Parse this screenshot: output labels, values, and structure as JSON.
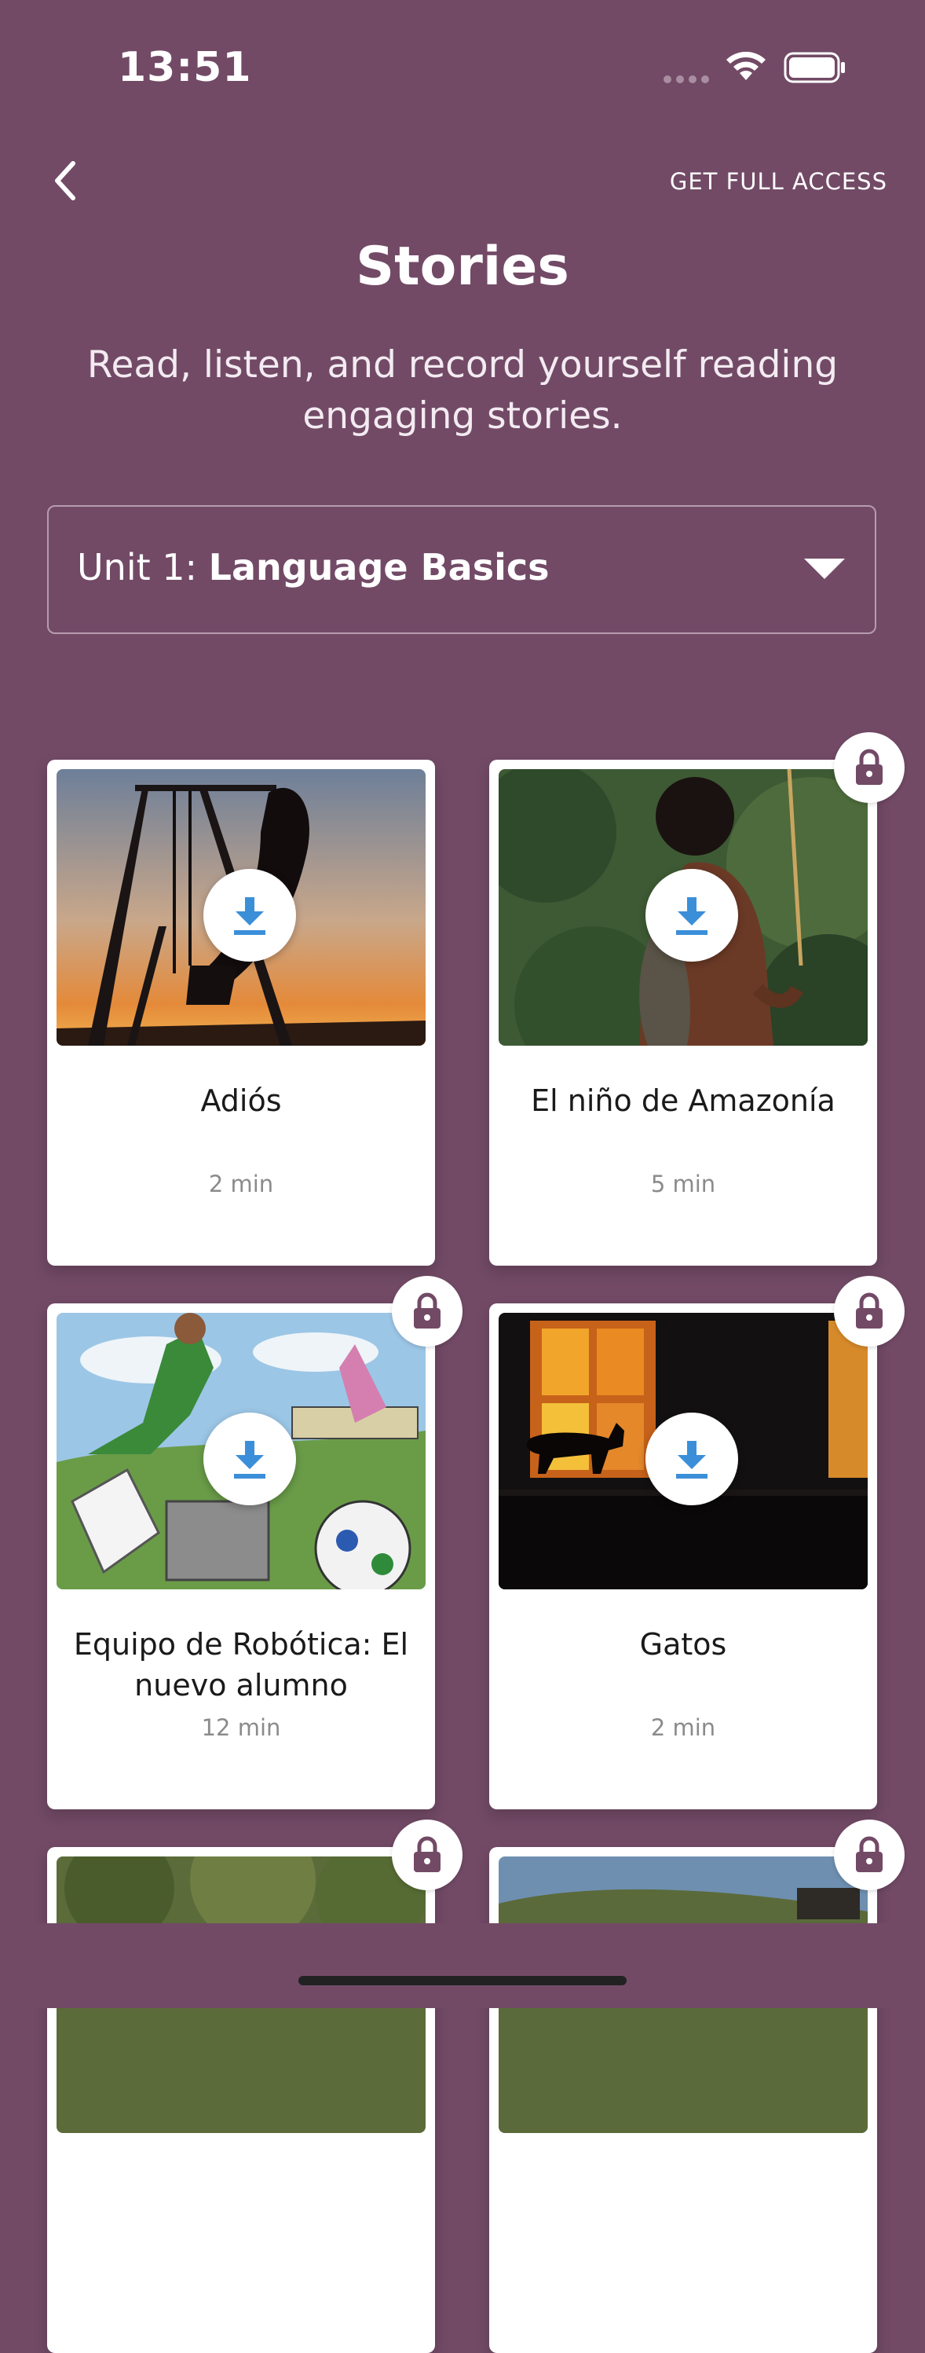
{
  "status_bar": {
    "time": "13:51"
  },
  "header": {
    "back_icon": "chevron-left-icon",
    "full_access_label": "GET FULL ACCESS",
    "title": "Stories",
    "subtitle": "Read, listen, and record yourself reading engaging stories."
  },
  "unit_selector": {
    "prefix": "Unit 1:",
    "name": "Language Basics",
    "caret_icon": "caret-down-icon"
  },
  "stories": [
    {
      "title": "Adiós",
      "duration": "2 min",
      "locked": false
    },
    {
      "title": "El niño de Amazonía",
      "duration": "5 min",
      "locked": true
    },
    {
      "title": "Equipo de Robótica: El nuevo alumno",
      "duration": "12 min",
      "locked": true
    },
    {
      "title": "Gatos",
      "duration": "2 min",
      "locked": true
    },
    {
      "title": "",
      "duration": "",
      "locked": true
    },
    {
      "title": "",
      "duration": "",
      "locked": true
    }
  ],
  "colors": {
    "background": "#724a66",
    "download_accent": "#3b8fd9",
    "lock_accent": "#724a66"
  }
}
